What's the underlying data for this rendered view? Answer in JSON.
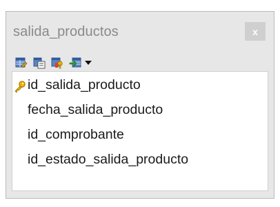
{
  "table": {
    "name": "salida_productos",
    "close_label": "x"
  },
  "toolbar": {
    "icons": [
      "edit-table-icon",
      "table-properties-icon",
      "keys-icon",
      "add-field-icon",
      "dropdown-arrow-icon"
    ]
  },
  "fields": [
    {
      "name": "id_salida_producto",
      "primary_key": true
    },
    {
      "name": "fecha_salida_producto",
      "primary_key": false
    },
    {
      "name": "id_comprobante",
      "primary_key": false
    },
    {
      "name": "id_estado_salida_producto",
      "primary_key": false
    }
  ],
  "colors": {
    "frame": "#e7e7e7",
    "title": "#8a8a8a",
    "close_button": "#cfcfcf",
    "key": "#e8a800"
  }
}
